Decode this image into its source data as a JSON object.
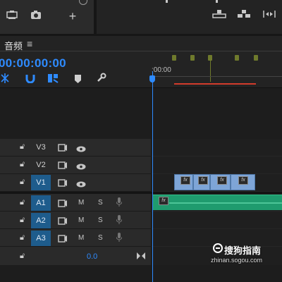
{
  "top_panel": {
    "left_icons": [
      "folder-icon",
      "camera-icon",
      "plus-icon"
    ],
    "right_icons": [
      "lift-icon",
      "extract-icon",
      "trim-icon"
    ]
  },
  "timeline": {
    "title": "音频",
    "menu_icon": "hamburger-menu-icon",
    "timecode": "00:00:00:00",
    "ruler_start": ":00:00",
    "tool_icons": [
      "snap-icon",
      "magnet-icon",
      "linked-selection-icon",
      "marker-icon",
      "wrench-icon"
    ],
    "tracks": [
      {
        "id": "v3",
        "label": "V3",
        "type": "video",
        "active": false
      },
      {
        "id": "v2",
        "label": "V2",
        "type": "video",
        "active": false
      },
      {
        "id": "v1",
        "label": "V1",
        "type": "video",
        "active": true
      },
      {
        "id": "a1",
        "label": "A1",
        "type": "audio",
        "active": true,
        "m": "M",
        "s": "S"
      },
      {
        "id": "a2",
        "label": "A2",
        "type": "audio",
        "active": true,
        "m": "M",
        "s": "S"
      },
      {
        "id": "a3",
        "label": "A3",
        "type": "audio",
        "active": true,
        "m": "M",
        "s": "S"
      }
    ],
    "master": {
      "value": "0.0"
    },
    "clip_badge": "fx"
  },
  "watermark": {
    "title": "搜狗指南",
    "url": "zhinan.sogou.com"
  },
  "colors": {
    "accent_blue": "#2e8bff",
    "video_clip": "#7ea5d7",
    "audio_clip": "#1f9b6e",
    "work_area": "#d23b2b",
    "marker": "#6f7a2c"
  }
}
